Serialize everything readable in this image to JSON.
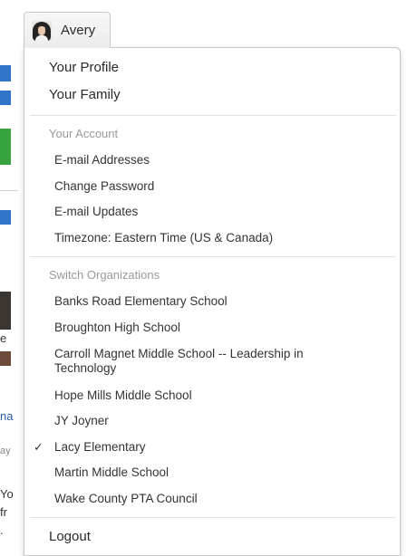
{
  "user_menu": {
    "user_name": "Avery",
    "avatar_icon": "user-avatar"
  },
  "menu": {
    "top_items": [
      {
        "label": "Your Profile"
      },
      {
        "label": "Your Family"
      }
    ],
    "account_section": {
      "label": "Your Account",
      "items": [
        {
          "label": "E-mail Addresses"
        },
        {
          "label": "Change Password"
        },
        {
          "label": "E-mail Updates"
        },
        {
          "label": "Timezone: Eastern Time (US & Canada)"
        }
      ]
    },
    "organizations_section": {
      "label": "Switch Organizations",
      "items": [
        {
          "label": "Banks Road Elementary School",
          "selected": false
        },
        {
          "label": "Broughton High School",
          "selected": false
        },
        {
          "label": "Carroll Magnet Middle School -- Leadership in Technology",
          "selected": false
        },
        {
          "label": "Hope Mills Middle School",
          "selected": false
        },
        {
          "label": "JY Joyner",
          "selected": false
        },
        {
          "label": "Lacy Elementary",
          "selected": true
        },
        {
          "label": "Martin Middle School",
          "selected": false
        },
        {
          "label": "Wake County PTA Council",
          "selected": false
        }
      ],
      "check_icon": "checkmark-icon"
    },
    "logout_label": "Logout"
  },
  "background_fragments": [
    "e",
    "na",
    "ay",
    "Yo",
    "fr",
    "."
  ],
  "colors": {
    "menu_border": "#c9c9c9",
    "section_label": "#9a9a9a",
    "bg_blue": "#2f74c8",
    "bg_green": "#37a33f"
  }
}
